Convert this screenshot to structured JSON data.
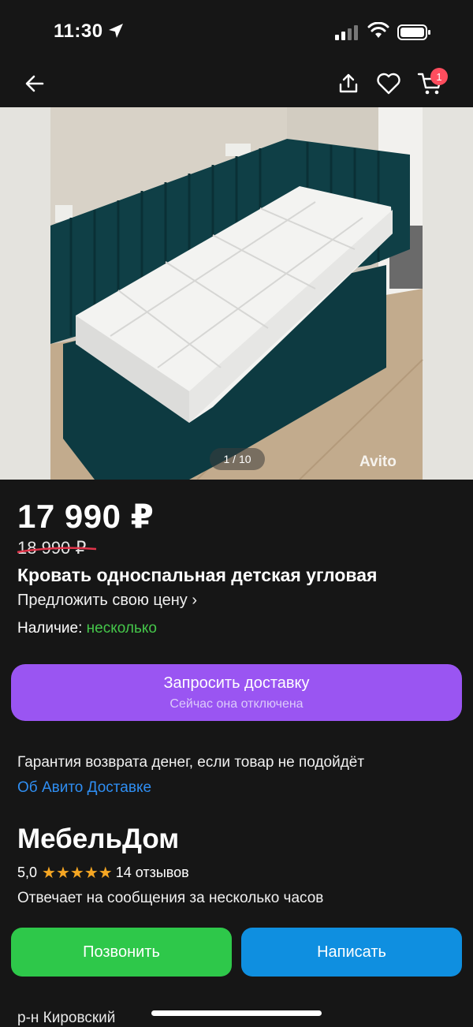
{
  "status_bar": {
    "time": "11:30"
  },
  "cart": {
    "badge_count": "1"
  },
  "gallery": {
    "counter": "1 / 10",
    "watermark": "Avito"
  },
  "listing": {
    "price": "17 990 ₽",
    "old_price": "18 990 ₽",
    "title": "Кровать односпальная детская угловая",
    "offer_price_label": "Предложить свою цену",
    "availability_label": "Наличие:",
    "availability_value": "несколько"
  },
  "delivery": {
    "button_title": "Запросить доставку",
    "button_subtitle": "Сейчас она отключена",
    "guarantee_text": "Гарантия возврата денег, если товар не подойдёт",
    "about_link": "Об Авито Доставке"
  },
  "seller": {
    "name": "МебельДом",
    "rating": "5,0",
    "stars": 5,
    "reviews": "14 отзывов",
    "reply_time": "Отвечает на сообщения за несколько часов"
  },
  "actions": {
    "call_label": "Позвонить",
    "write_label": "Написать"
  },
  "location": {
    "district": "р-н Кировский"
  },
  "colors": {
    "purple": "#9a55f2",
    "green": "#2ec84a",
    "blue": "#0f8fe0",
    "link": "#2f8ef2",
    "availability": "#45c64a",
    "badge": "#ff4d5e",
    "star": "#f5a623"
  }
}
